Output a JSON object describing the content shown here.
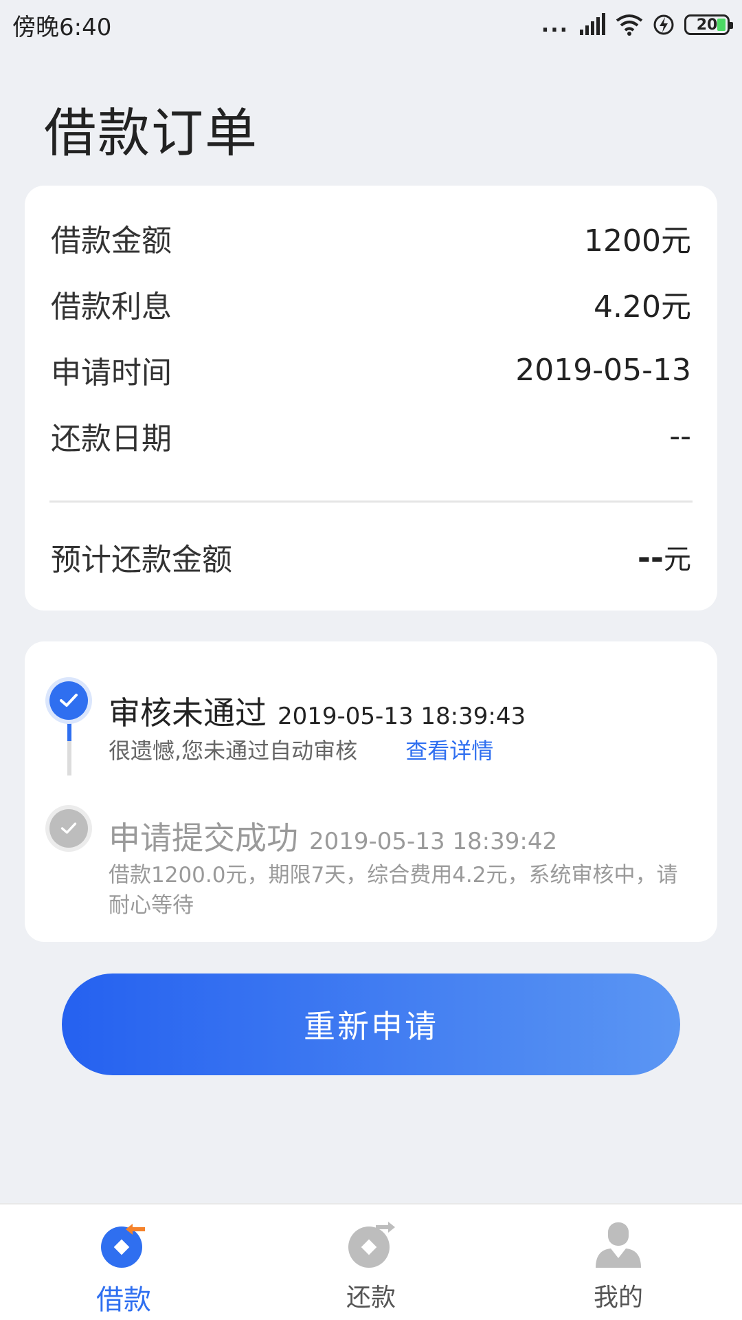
{
  "status_bar": {
    "time": "傍晚6:40",
    "signal_dots": "...",
    "battery_level": "20"
  },
  "page": {
    "title": "借款订单"
  },
  "loan_info": {
    "rows": [
      {
        "label": "借款金额",
        "value": "1200元"
      },
      {
        "label": "借款利息",
        "value": "4.20元"
      },
      {
        "label": "申请时间",
        "value": "2019-05-13"
      },
      {
        "label": "还款日期",
        "value": "--"
      }
    ],
    "expected_repayment": {
      "label": "预计还款金额",
      "value": "--",
      "unit": "元"
    }
  },
  "timeline": {
    "events": [
      {
        "title": "审核未通过",
        "time": "2019-05-13 18:39:43",
        "description": "很遗憾,您未通过自动审核",
        "link_label": "查看详情"
      },
      {
        "title": "申请提交成功",
        "time": "2019-05-13 18:39:42",
        "description": "借款1200.0元，期限7天，综合费用4.2元，系统审核中，请耐心等待"
      }
    ]
  },
  "actions": {
    "reapply_label": "重新申请"
  },
  "bottom_nav": {
    "items": [
      {
        "label": "借款",
        "icon": "loan-icon",
        "active": true
      },
      {
        "label": "还款",
        "icon": "repay-icon",
        "active": false
      },
      {
        "label": "我的",
        "icon": "profile-icon",
        "active": false
      }
    ]
  },
  "colors": {
    "primary": "#2f6ff0",
    "accent_orange": "#f5822a",
    "inactive_grey": "#bdbdbd",
    "background": "#eef0f4"
  }
}
